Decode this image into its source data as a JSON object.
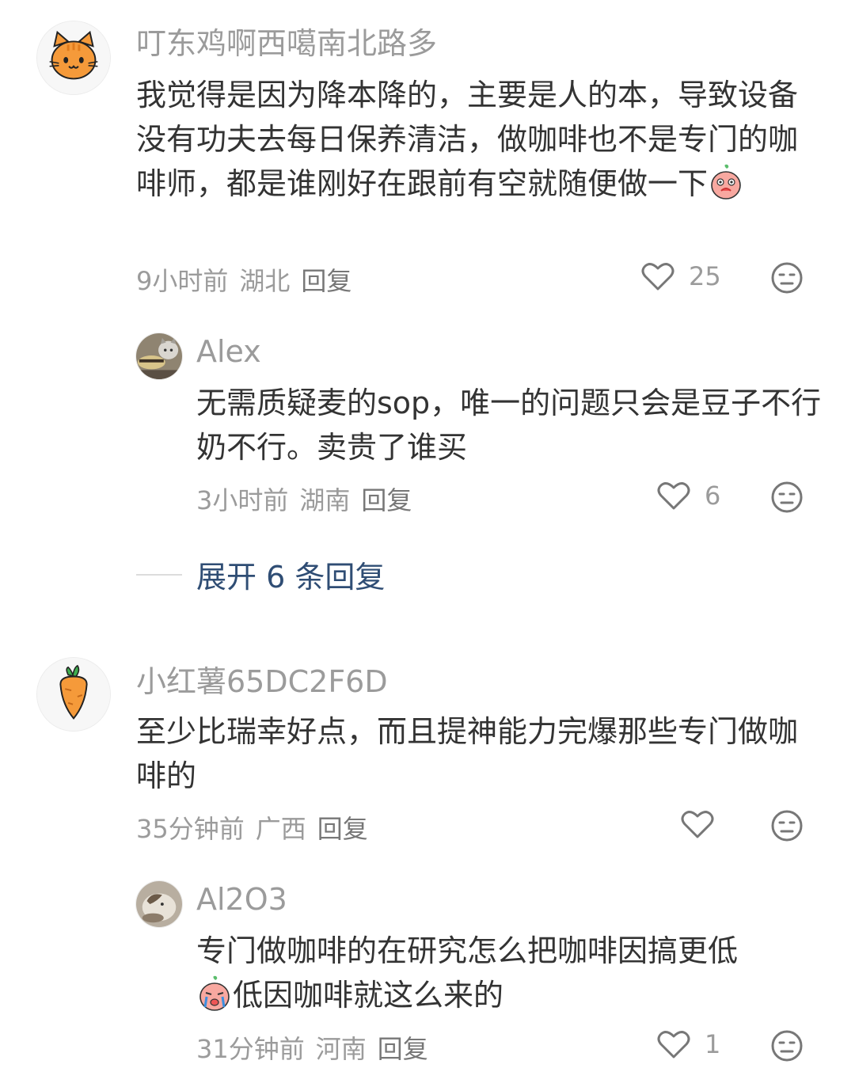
{
  "comments": [
    {
      "username": "叮东鸡啊西噶南北路多",
      "text": "我觉得是因为降本降的，主要是人的本，导致设备没有功夫去每日保养清洁，做咖啡也不是专门的咖啡师，都是谁刚好在跟前有空就随便做一下",
      "time": "9小时前",
      "location": "湖北",
      "reply_label": "回复",
      "likes": "25",
      "avatar_icon": "orange-cat-avatar-icon",
      "replies": [
        {
          "username": "Alex",
          "text": "无需质疑麦的sop，唯一的问题只会是豆子不行 奶不行。卖贵了谁买",
          "time": "3小时前",
          "location": "湖南",
          "reply_label": "回复",
          "likes": "6",
          "avatar_icon": "cat-photo-avatar-icon"
        }
      ],
      "expand_label": "展开 6 条回复"
    },
    {
      "username": "小红薯65DC2F6D",
      "text": "至少比瑞幸好点，而且提神能力完爆那些专门做咖啡的",
      "time": "35分钟前",
      "location": "广西",
      "reply_label": "回复",
      "likes": "",
      "avatar_icon": "carrot-avatar-icon",
      "replies": [
        {
          "username": "Al2O3",
          "text": "低因咖啡就这么来的",
          "text_line1": "专门做咖啡的在研究怎么把咖啡因搞更低",
          "time": "31分钟前",
          "location": "河南",
          "reply_label": "回复",
          "likes": "1",
          "avatar_icon": "cat-photo-avatar-icon"
        }
      ]
    }
  ],
  "colors": {
    "name": "#9b9b9b",
    "text": "#333333",
    "link": "#2f4d74"
  }
}
